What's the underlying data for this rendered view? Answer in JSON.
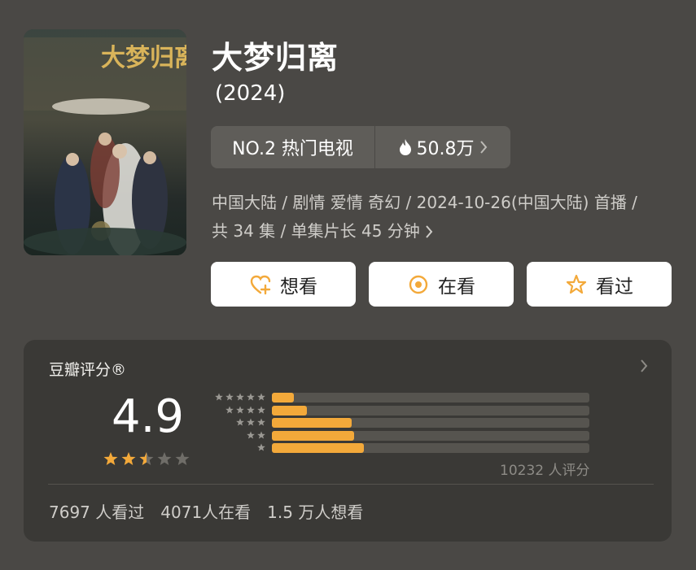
{
  "poster": {
    "title_text": "大梦归离"
  },
  "title": "大梦归离",
  "year": "(2024)",
  "rank": {
    "label": "NO.2 热门电视",
    "heat": "50.8万"
  },
  "meta": {
    "line1": "中国大陆 / 剧情 爱情 奇幻 / 2024-10-26(中国大陆) 首播 /",
    "line2": "共 34 集 / 单集片长 45 分钟"
  },
  "actions": [
    {
      "label": "想看",
      "icon": "heart-plus-icon"
    },
    {
      "label": "在看",
      "icon": "target-circle-icon"
    },
    {
      "label": "看过",
      "icon": "star-outline-icon"
    }
  ],
  "rating": {
    "title": "豆瓣评分®",
    "score": "4.9",
    "stars": 2.5,
    "distribution": [
      {
        "stars": 5,
        "fraction": 0.07
      },
      {
        "stars": 4,
        "fraction": 0.11
      },
      {
        "stars": 3,
        "fraction": 0.25
      },
      {
        "stars": 2,
        "fraction": 0.26
      },
      {
        "stars": 1,
        "fraction": 0.29
      }
    ],
    "count_text": "10232 人评分"
  },
  "stats": {
    "watched": "7697 人看过",
    "watching": "4071人在看",
    "want": "1.5 万人想看"
  },
  "colors": {
    "accent": "#f3a93a",
    "background": "#4a4845",
    "card": "#3a3936"
  }
}
